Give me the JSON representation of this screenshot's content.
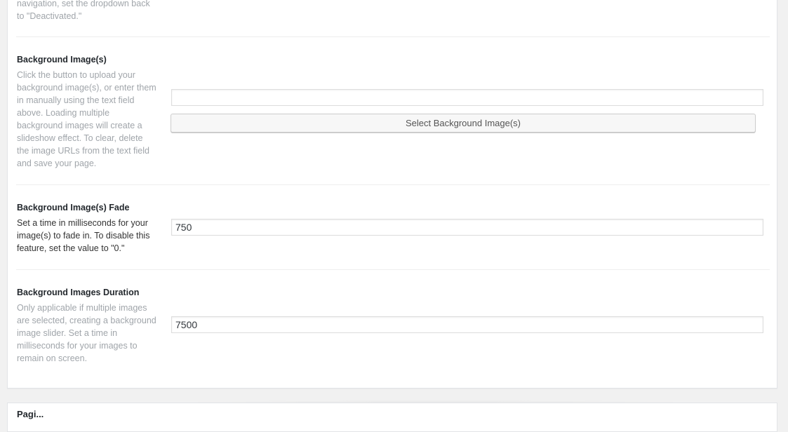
{
  "prev_section": {
    "desc_tail": "navigation, set the dropdown back to \"Deactivated.\""
  },
  "bg_images": {
    "label": "Background Image(s)",
    "description": "Click the button to upload your background image(s), or enter them in manually using the text field above. Loading multiple background images will create a slideshow effect. To clear, delete the image URLs from the text field and save your page.",
    "input_value": "",
    "button_label": "Select Background Image(s)"
  },
  "bg_fade": {
    "label": "Background Image(s) Fade",
    "description": "Set a time in milliseconds for your image(s) to fade in. To disable this feature, set the value to \"0.\"",
    "input_value": "750"
  },
  "bg_duration": {
    "label": "Background Images Duration",
    "description": "Only applicable if multiple images are selected, creating a background image slider. Set a time in milliseconds for your images to remain on screen.",
    "input_value": "7500"
  },
  "next_panel": {
    "title": "Pagi..."
  }
}
